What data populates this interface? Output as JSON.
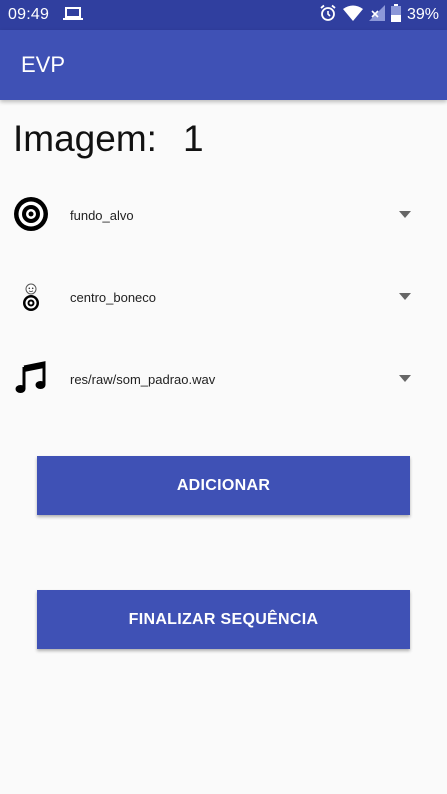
{
  "status_bar": {
    "time": "09:49",
    "battery": "39%",
    "icons": [
      "laptop-icon",
      "alarm-icon",
      "wifi-icon",
      "signal-icon",
      "battery-icon"
    ]
  },
  "app_bar": {
    "title": "EVP"
  },
  "heading": {
    "label": "Imagem:",
    "number": "1"
  },
  "spinners": [
    {
      "icon": "target-icon",
      "value": "fundo_alvo"
    },
    {
      "icon": "puppet-target-icon",
      "value": "centro_boneco"
    },
    {
      "icon": "music-note-icon",
      "value": "res/raw/som_padrao.wav"
    }
  ],
  "buttons": {
    "add": "ADICIONAR",
    "finish": "FINALIZAR SEQUÊNCIA"
  },
  "colors": {
    "status_bar": "#303f9f",
    "primary": "#3f51b5",
    "background": "#fafafa"
  }
}
